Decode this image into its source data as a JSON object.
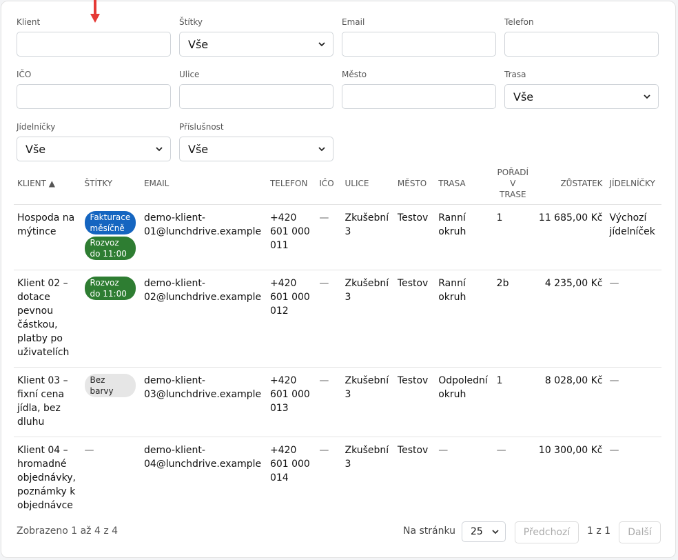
{
  "filters": {
    "row1": [
      {
        "label": "Klient",
        "type": "input",
        "value": ""
      },
      {
        "label": "Štítky",
        "type": "select",
        "value": "Vše"
      },
      {
        "label": "Email",
        "type": "input",
        "value": ""
      },
      {
        "label": "Telefon",
        "type": "input",
        "value": ""
      }
    ],
    "row2": [
      {
        "label": "IČO",
        "type": "input",
        "value": ""
      },
      {
        "label": "Ulice",
        "type": "input",
        "value": ""
      },
      {
        "label": "Město",
        "type": "input",
        "value": ""
      },
      {
        "label": "Trasa",
        "type": "select",
        "value": "Vše"
      }
    ],
    "row3": [
      {
        "label": "Jídelníčky",
        "type": "select",
        "value": "Vše"
      },
      {
        "label": "Příslušnost",
        "type": "select",
        "value": "Vše"
      }
    ]
  },
  "table": {
    "headers": {
      "client": "KLIENT ▲",
      "tags": "ŠTÍTKY",
      "email": "EMAIL",
      "phone": "TELEFON",
      "ico": "IČO",
      "street": "ULICE",
      "city": "MĚSTO",
      "route": "TRASA",
      "order": "POŘADÍ V TRASE",
      "balance": "ZŮSTATEK",
      "menus": "JÍDELNÍČKY"
    },
    "rows": [
      {
        "client": "Hospoda na mýtince",
        "tags": [
          {
            "text": "Fakturace měsíčně",
            "color": "#1565c0"
          },
          {
            "text": "Rozvoz do 11:00",
            "color": "#2e7d32"
          }
        ],
        "email": "demo-klient-01@lunchdrive.example",
        "phone": "+420 601 000 011",
        "ico": "—",
        "street": "Zkušební 3",
        "city": "Testov",
        "route": "Ranní okruh",
        "order": "1",
        "balance": "11 685,00 Kč",
        "menus": "Výchozí jídelníček"
      },
      {
        "client": "Klient 02 – dotace pevnou částkou, platby po uživatelích",
        "tags": [
          {
            "text": "Rozvoz do 11:00",
            "color": "#2e7d32"
          }
        ],
        "email": "demo-klient-02@lunchdrive.example",
        "phone": "+420 601 000 012",
        "ico": "—",
        "street": "Zkušební 3",
        "city": "Testov",
        "route": "Ranní okruh",
        "order": "2b",
        "balance": "4 235,00 Kč",
        "menus": "—"
      },
      {
        "client": "Klient 03 – fixní cena jídla, bez dluhu",
        "tags": [
          {
            "text": "Bez barvy",
            "color": "#e6e6e6"
          }
        ],
        "email": "demo-klient-03@lunchdrive.example",
        "phone": "+420 601 000 013",
        "ico": "—",
        "street": "Zkušební 3",
        "city": "Testov",
        "route": "Odpolední okruh",
        "order": "1",
        "balance": "8 028,00 Kč",
        "menus": "—"
      },
      {
        "client": "Klient 04 – hromadné objednávky, poznámky k objednávce",
        "tags": [],
        "email": "demo-klient-04@lunchdrive.example",
        "phone": "+420 601 000 014",
        "ico": "—",
        "street": "Zkušební 3",
        "city": "Testov",
        "route": "—",
        "order": "—",
        "balance": "10 300,00 Kč",
        "menus": "—"
      }
    ],
    "empty_tags": "—"
  },
  "footer": {
    "summary": "Zobrazeno 1 až 4 z 4",
    "per_page_label": "Na stránku",
    "per_page_value": "25",
    "prev_label": "Předchozí",
    "page_info": "1 z 1",
    "next_label": "Další"
  },
  "colors": {
    "accent_arrow": "#e53935"
  }
}
